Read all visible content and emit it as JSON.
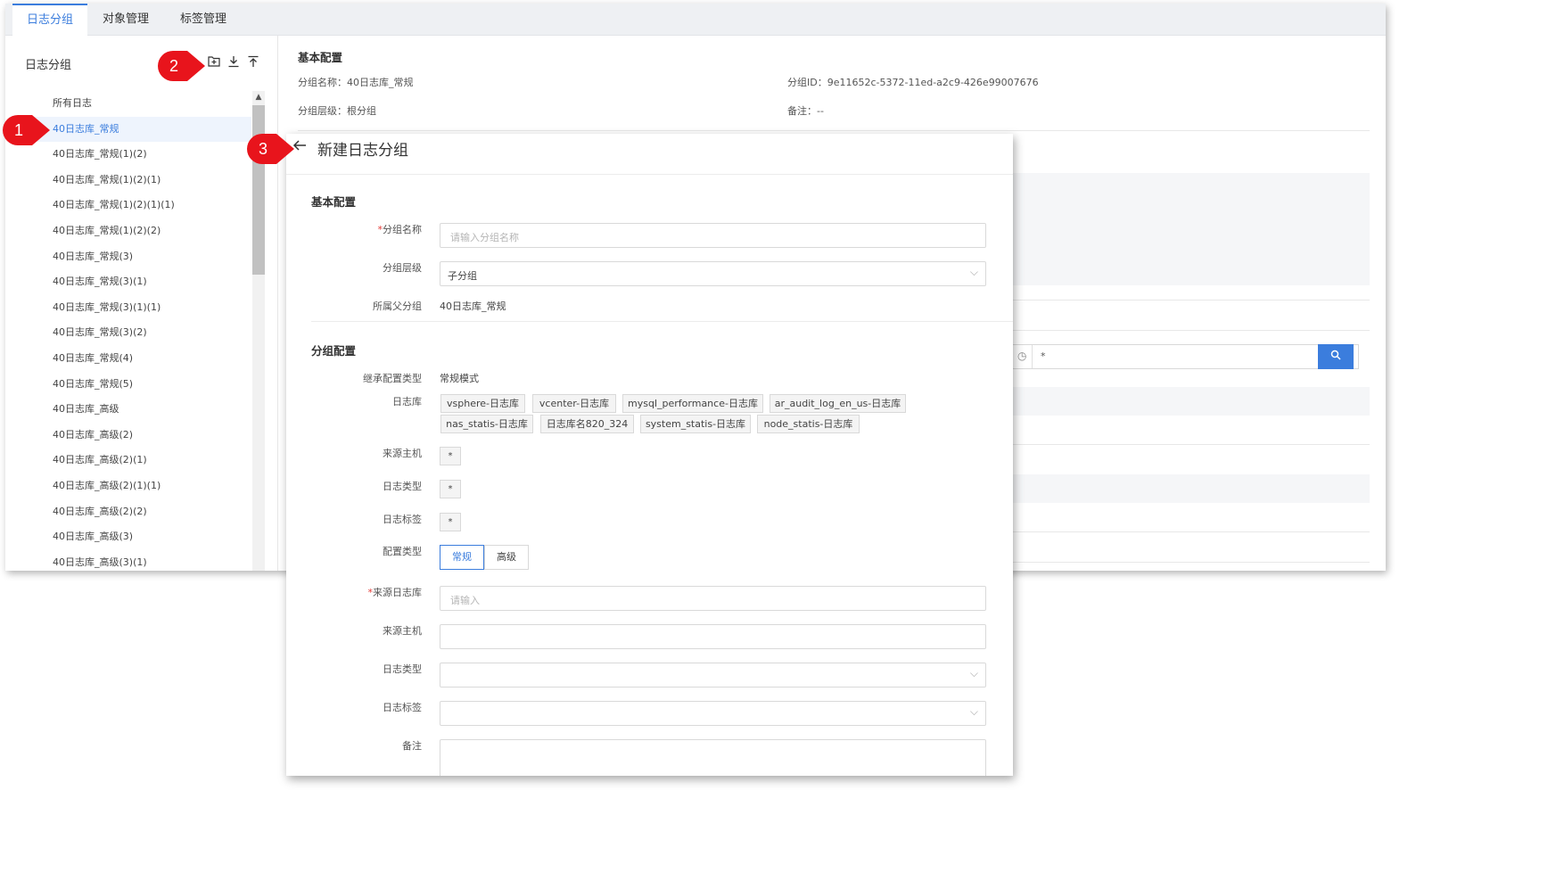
{
  "tabs": [
    "日志分组",
    "对象管理",
    "标签管理"
  ],
  "sidebar": {
    "title": "日志分组",
    "tools": [
      "folder-plus-icon",
      "download-icon",
      "upload-icon"
    ],
    "tree": [
      "所有日志",
      "40日志库_常规",
      "40日志库_常规(1)(2)",
      "40日志库_常规(1)(2)(1)",
      "40日志库_常规(1)(2)(1)(1)",
      "40日志库_常规(1)(2)(2)",
      "40日志库_常规(3)",
      "40日志库_常规(3)(1)",
      "40日志库_常规(3)(1)(1)",
      "40日志库_常规(3)(2)",
      "40日志库_常规(4)",
      "40日志库_常规(5)",
      "40日志库_高级",
      "40日志库_高级(2)",
      "40日志库_高级(2)(1)",
      "40日志库_高级(2)(1)(1)",
      "40日志库_高级(2)(2)",
      "40日志库_高级(3)",
      "40日志库_高级(3)(1)"
    ],
    "selected_index": 1
  },
  "detail": {
    "section": "基本配置",
    "name": "分组名称：40日志库_常规",
    "id": "分组ID：9e11652c-5372-11ed-a2c9-426e99007676",
    "level": "分组层级：根分组",
    "note": "备注：--",
    "search_value": "*"
  },
  "panel": {
    "title": "新建日志分组",
    "basic_section": "基本配置",
    "group_section": "分组配置",
    "labels": {
      "name": "分组名称",
      "level": "分组层级",
      "parent": "所属父分组",
      "inherit": "继承配置类型",
      "repo": "日志库",
      "host": "来源主机",
      "logtype": "日志类型",
      "logtag": "日志标签",
      "configtype": "配置类型",
      "srcrepo": "来源日志库",
      "host2": "来源主机",
      "logtype2": "日志类型",
      "logtag2": "日志标签",
      "remark": "备注"
    },
    "name_placeholder": "请输入分组名称",
    "level_value": "子分组",
    "parent_value": "40日志库_常规",
    "inherit_value": "常规模式",
    "repos": [
      "vsphere-日志库",
      "vcenter-日志库",
      "mysql_performance-日志库",
      "ar_audit_log_en_us-日志库",
      "nas_statis-日志库",
      "日志库名820_324",
      "system_statis-日志库",
      "node_statis-日志库"
    ],
    "star": "*",
    "config_options": [
      "常规",
      "高级"
    ],
    "config_selected": "常规",
    "srcrepo_placeholder": "请输入"
  },
  "callouts": [
    "1",
    "2",
    "3"
  ],
  "colors": {
    "accent": "#3b7ddd",
    "callout": "#e8141c",
    "required": "#e53935"
  }
}
